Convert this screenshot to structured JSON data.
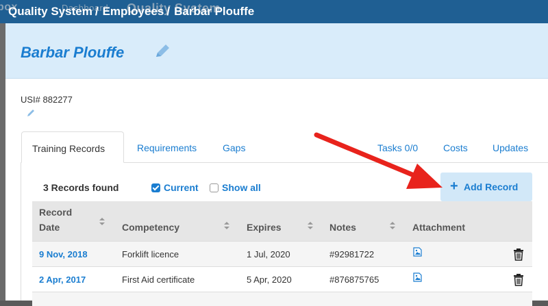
{
  "background_app": {
    "brand_fragment": "box",
    "nav_dashboard": "Dashboard",
    "nav_quality_system": "Quality System"
  },
  "breadcrumb": {
    "items": [
      "Quality System",
      "Employees",
      "Barbar Plouffe"
    ],
    "separator": "/"
  },
  "employee": {
    "name": "Barbar Plouffe",
    "usi": "USI# 882277"
  },
  "tabs": {
    "training_records": "Training Records",
    "requirements": "Requirements",
    "gaps": "Gaps",
    "tasks": "Tasks 0/0",
    "costs": "Costs",
    "updates": "Updates"
  },
  "records": {
    "count_label": "3 Records found",
    "filter_current": "Current",
    "filter_current_checked": true,
    "filter_show_all": "Show all",
    "filter_show_all_checked": false,
    "add_button_label": "Add Record",
    "add_button_icon": "plus-icon"
  },
  "table": {
    "headers": {
      "record_date_line1": "Record",
      "record_date_line2": "Date",
      "competency": "Competency",
      "expires": "Expires",
      "notes": "Notes",
      "attachment": "Attachment"
    },
    "rows": [
      {
        "record_date": "9 Nov, 2018",
        "competency": "Forklift licence",
        "expires": "1 Jul, 2020",
        "notes": "#92981722",
        "attachment_icon": "image-file-icon",
        "delete_icon": "trash-icon"
      },
      {
        "record_date": "2 Apr, 2017",
        "competency": "First Aid certificate",
        "expires": "5 Apr, 2020",
        "notes": "#876875765",
        "attachment_icon": "image-file-icon",
        "delete_icon": "trash-icon"
      }
    ]
  },
  "colors": {
    "accent": "#1a7dd0",
    "header_bg": "#d9ecfa",
    "topbar_bg": "#1f5f93",
    "annotation_arrow": "#e8231c"
  }
}
